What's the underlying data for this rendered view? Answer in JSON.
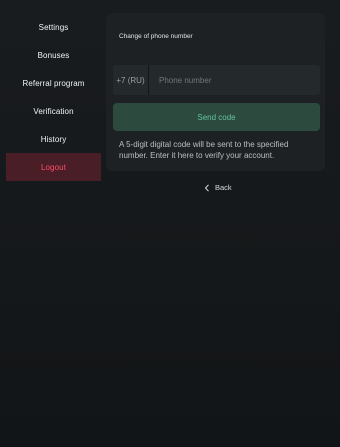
{
  "sidebar": {
    "items": [
      {
        "label": "Settings"
      },
      {
        "label": "Bonuses"
      },
      {
        "label": "Referral program"
      },
      {
        "label": "Verification"
      },
      {
        "label": "History"
      },
      {
        "label": "Logout"
      }
    ]
  },
  "phone_change": {
    "title": "Change of phone number",
    "prefix": "+7 (RU)",
    "placeholder": "Phone number",
    "value": "",
    "send_label": "Send code",
    "info": "A 5-digit digital code will be sent to the specified number. Enter it here to verify your account."
  },
  "back": {
    "label": "Back",
    "icon": "chevron-left-icon"
  },
  "colors": {
    "logout_bg": "#4a1e27",
    "logout_text": "#ff4d6a",
    "send_bg": "#2d4a3f",
    "send_text": "#63c49c"
  }
}
